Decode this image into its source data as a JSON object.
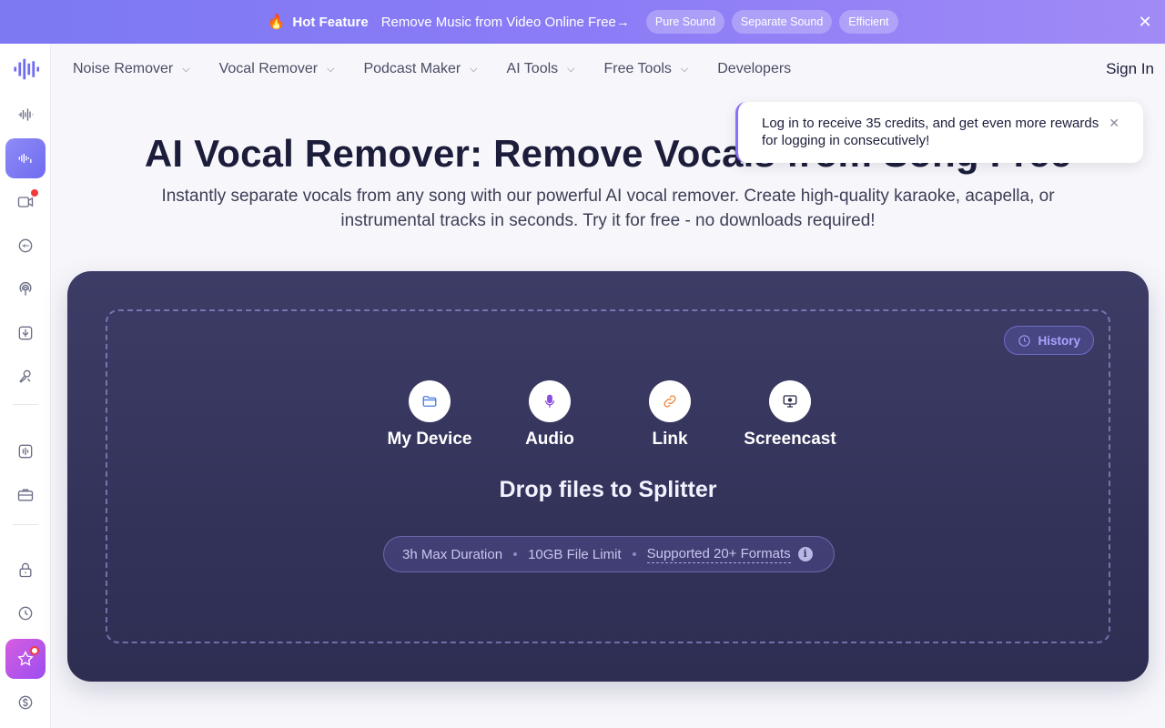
{
  "banner": {
    "fire_icon": "🔥",
    "hot_label": "Hot Feature",
    "message": "Remove Music from Video Online Free→",
    "pills": [
      "Pure Sound",
      "Separate Sound",
      "Efficient"
    ],
    "close_glyph": "✕"
  },
  "sidebar": {
    "icons": [
      "logo-waveform-icon",
      "audio-wave-icon",
      "vocal-remover-icon",
      "video-icon",
      "speed-icon",
      "podcast-icon",
      "mic-icon",
      "voice-icon",
      "equalizer-icon",
      "toolbox-icon",
      "lock-icon",
      "clock-icon",
      "star-icon",
      "dollar-icon"
    ]
  },
  "nav": {
    "items": [
      {
        "label": "Noise Remover",
        "dropdown": true
      },
      {
        "label": "Vocal Remover",
        "dropdown": true
      },
      {
        "label": "Podcast Maker",
        "dropdown": true
      },
      {
        "label": "AI Tools",
        "dropdown": true
      },
      {
        "label": "Free Tools",
        "dropdown": true
      },
      {
        "label": "Developers",
        "dropdown": false
      }
    ],
    "chevron": "⌵",
    "sign_in": "Sign In"
  },
  "hero": {
    "title": "AI Vocal Remover: Remove Vocals from Song Free",
    "subtitle": "Instantly separate vocals from any song with our powerful AI vocal remover. Create high-quality karaoke, acapella, or instrumental tracks in seconds. Try it for free - no downloads required!"
  },
  "toast": {
    "message": "Log in to receive 35 credits, and get even more rewards for logging in consecutively!",
    "close_glyph": "✕"
  },
  "upload": {
    "history_label": "History",
    "sources": [
      {
        "label": "My Device",
        "icon": "folder-icon",
        "color": "#4a7de0"
      },
      {
        "label": "Audio",
        "icon": "mic-icon",
        "color": "#8b4fe0"
      },
      {
        "label": "Link",
        "icon": "link-icon",
        "color": "#f0883a"
      },
      {
        "label": "Screencast",
        "icon": "monitor-icon",
        "color": "#2a2c4a"
      }
    ],
    "drop_title": "Drop files to Splitter",
    "limits": [
      "3h Max Duration",
      "10GB File Limit",
      "Supported 20+ Formats"
    ],
    "info_glyph": "i"
  },
  "colors": {
    "accent": "#7c79f3",
    "card_bg": "#34335b"
  }
}
